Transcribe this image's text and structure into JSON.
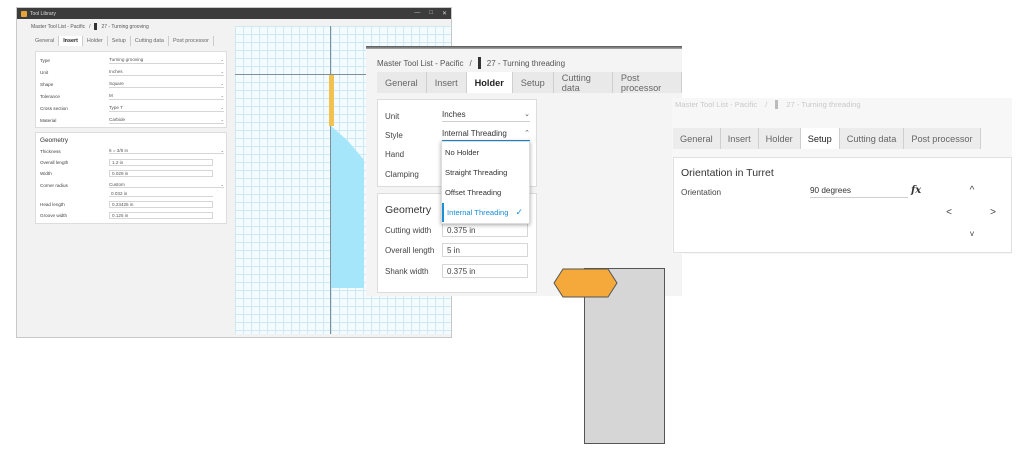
{
  "win1": {
    "title": "Tool Library",
    "crumb_root": "Master Tool List - Pacific",
    "crumb_sep": "/",
    "crumb_tool": "27 - Turning grooving",
    "tabs": [
      "General",
      "Insert",
      "Holder",
      "Setup",
      "Cutting data",
      "Post processor"
    ],
    "insert_fields": [
      {
        "label": "Type",
        "value": "Turning grooving"
      },
      {
        "label": "Unit",
        "value": "Inches"
      },
      {
        "label": "Shape",
        "value": "Square"
      },
      {
        "label": "Tolerance",
        "value": "M"
      },
      {
        "label": "Cross section",
        "value": "Type T"
      },
      {
        "label": "Material",
        "value": "Carbide"
      }
    ],
    "geometry_title": "Geometry",
    "geometry": {
      "thickness_label": "Thickness",
      "thickness_value": "6 = 3/8 in",
      "overall_length_label": "Overall length",
      "overall_length_value": "1.2 in",
      "width_label": "Width",
      "width_value": "0.029 in",
      "corner_radius_label": "Corner radius",
      "corner_radius_select": "Custom",
      "corner_radius_value": "0.032 in",
      "head_length_label": "Head length",
      "head_length_value": "0.23425 in",
      "groove_width_label": "Groove width",
      "groove_width_value": "0.125 in"
    }
  },
  "win2": {
    "crumb_root": "Master Tool List - Pacific",
    "crumb_sep": "/",
    "crumb_tool": "27 - Turning threading",
    "tabs": [
      "General",
      "Insert",
      "Holder",
      "Setup",
      "Cutting data",
      "Post processor"
    ],
    "unit_label": "Unit",
    "unit_value": "Inches",
    "style_label": "Style",
    "style_value": "Internal Threading",
    "hand_label": "Hand",
    "clamping_label": "Clamping",
    "style_options": [
      "No Holder",
      "Straight Threading",
      "Offset Threading",
      "Internal Threading"
    ],
    "geometry_title": "Geometry",
    "cutting_width_label": "Cutting width",
    "cutting_width_value": "0.375 in",
    "overall_length_label": "Overall length",
    "overall_length_value": "5 in",
    "shank_width_label": "Shank width",
    "shank_width_value": "0.375 in"
  },
  "win3": {
    "crumb_root": "Master Tool List - Pacific",
    "crumb_sep": "/",
    "crumb_tool": "27 - Turning threading",
    "tabs": [
      "General",
      "Insert",
      "Holder",
      "Setup",
      "Cutting data",
      "Post processor"
    ],
    "orientation_title": "Orientation in Turret",
    "orientation_label": "Orientation",
    "orientation_value": "90 degrees",
    "fx_label": "fx"
  },
  "icons": {
    "minimize": "—",
    "maximize": "□",
    "close": "✕",
    "chevron_down": "⌄",
    "chevron_up": "⌃",
    "check": "✓",
    "arrow_up": "^",
    "arrow_left": "<",
    "arrow_right": ">",
    "arrow_down": "v"
  },
  "colors": {
    "accent_blue": "#1a8fd6",
    "insert_yellow": "#f2c14e",
    "shank_cyan": "#a6e6fb",
    "hex_orange": "#f4a93a",
    "shank_gray": "#d6d6d6"
  }
}
